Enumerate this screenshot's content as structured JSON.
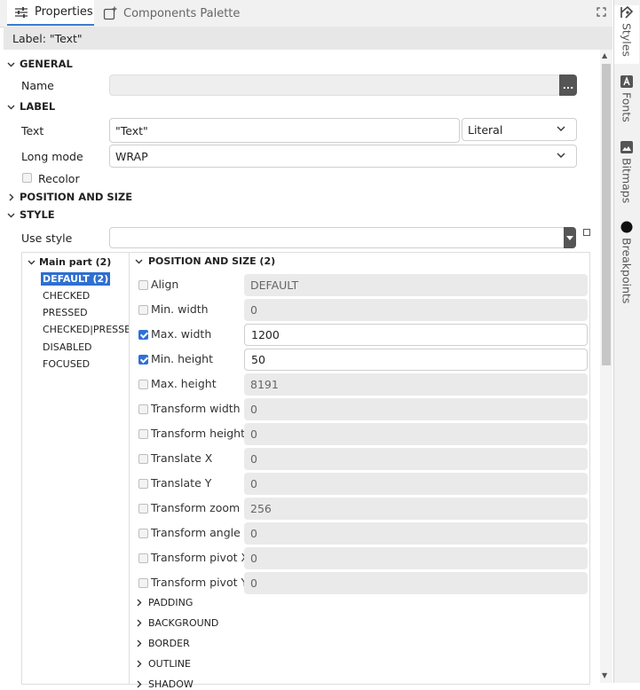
{
  "tabs": [
    {
      "label": "Properties",
      "icon": "sliders-icon",
      "active": true
    },
    {
      "label": "Components Palette",
      "icon": "add-component-icon",
      "active": false
    }
  ],
  "label_bar": "Label: \"Text\"",
  "side_tabs": [
    "Styles",
    "Fonts",
    "Bitmaps",
    "Breakpoints"
  ],
  "sections": {
    "general": "GENERAL",
    "label": "LABEL",
    "position_and_size": "POSITION AND SIZE",
    "style": "STYLE"
  },
  "general": {
    "name_label": "Name",
    "name_value": "",
    "ellipsis": "..."
  },
  "label": {
    "text_label": "Text",
    "text_value": "\"Text\"",
    "text_mode": "Literal",
    "long_mode_label": "Long mode",
    "long_mode_value": "WRAP",
    "recolor_label": "Recolor",
    "recolor_checked": false
  },
  "style": {
    "use_style_label": "Use style",
    "use_style_value": "",
    "tree_head": "Main part (2)",
    "tree_items": [
      "DEFAULT (2)",
      "CHECKED",
      "PRESSED",
      "CHECKED|PRESSED",
      "DISABLED",
      "FOCUSED"
    ],
    "selected_item": "DEFAULT (2)"
  },
  "props": {
    "header": "POSITION AND SIZE (2)",
    "rows": [
      {
        "label": "Align",
        "value": "DEFAULT",
        "checked": false
      },
      {
        "label": "Min. width",
        "value": "0",
        "checked": false
      },
      {
        "label": "Max. width",
        "value": "1200",
        "checked": true
      },
      {
        "label": "Min. height",
        "value": "50",
        "checked": true
      },
      {
        "label": "Max. height",
        "value": "8191",
        "checked": false
      },
      {
        "label": "Transform width",
        "value": "0",
        "checked": false
      },
      {
        "label": "Transform height",
        "value": "0",
        "checked": false
      },
      {
        "label": "Translate X",
        "value": "0",
        "checked": false
      },
      {
        "label": "Translate Y",
        "value": "0",
        "checked": false
      },
      {
        "label": "Transform zoom",
        "value": "256",
        "checked": false
      },
      {
        "label": "Transform angle",
        "value": "0",
        "checked": false
      },
      {
        "label": "Transform pivot X",
        "value": "0",
        "checked": false
      },
      {
        "label": "Transform pivot Y",
        "value": "0",
        "checked": false
      }
    ],
    "subsections": [
      "PADDING",
      "BACKGROUND",
      "BORDER",
      "OUTLINE",
      "SHADOW"
    ]
  },
  "colors": {
    "accent": "#2f6fd8",
    "selected": "#2e6fd1"
  }
}
